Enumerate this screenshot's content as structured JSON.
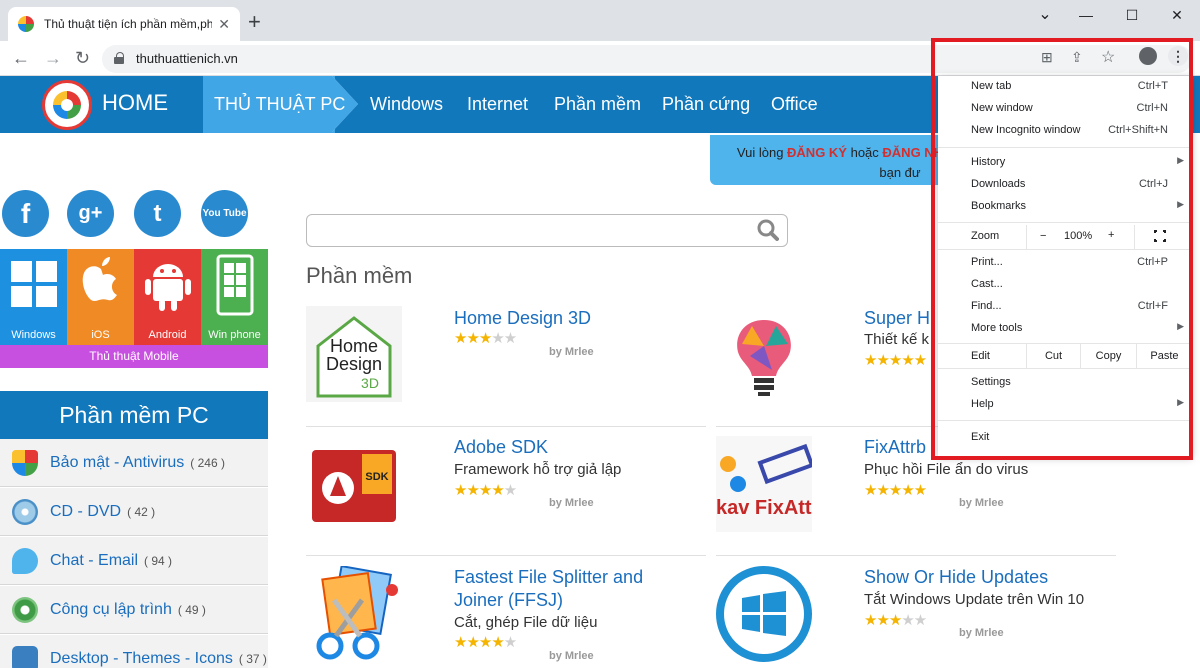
{
  "browser": {
    "tab_title": "Thủ thuật tiện ích phần mềm,phần",
    "tab_close": "✕",
    "new_tab": "+",
    "url": "thuthuattienich.vn",
    "min": "—",
    "max": "☐",
    "close": "✕",
    "chevron": "⌄"
  },
  "nav": {
    "home": "HOME",
    "active": "THỦ THUẬT PC",
    "items": [
      "Windows",
      "Internet",
      "Phần mềm",
      "Phần cứng",
      "Office"
    ]
  },
  "notice": {
    "line1a": "Vui lòng ",
    "line1b": "ĐĂNG KÝ",
    "line1c": " hoặc ",
    "line1d": "ĐĂNG NH",
    "line2": "bạn đư"
  },
  "social": [
    "f",
    "g+",
    "t",
    "You Tube"
  ],
  "mobile": {
    "tiles": [
      "Windows",
      "iOS",
      "Android",
      "Win phone"
    ],
    "bar": "Thủ thuật Mobile"
  },
  "sidebar": {
    "header": "Phần mềm PC",
    "items": [
      {
        "label": "Bảo mật - Antivirus",
        "count": "( 246 )"
      },
      {
        "label": "CD - DVD",
        "count": "( 42 )"
      },
      {
        "label": "Chat - Email",
        "count": "( 94 )"
      },
      {
        "label": "Công cụ lập trình",
        "count": "( 49 )"
      },
      {
        "label": "Desktop - Themes - Icons",
        "count": "( 37 )"
      }
    ]
  },
  "main": {
    "section_title": "Phần mềm",
    "by": "by Mrlee",
    "cards": [
      {
        "title": "Home Design 3D",
        "desc": "",
        "rating": 3
      },
      {
        "title": "Super H",
        "desc": "Thiết kế k",
        "rating": 5
      },
      {
        "title": "Adobe SDK",
        "desc": "Framework hỗ trợ giả lập",
        "rating": 4
      },
      {
        "title": "FixAttrb",
        "desc": "Phục hồi File ẩn do virus",
        "rating": 5
      },
      {
        "title": "Fastest File Splitter and",
        "title2": "Joiner (FFSJ)",
        "desc": "Cắt, ghép File dữ liệu",
        "rating": 4
      },
      {
        "title": "Show Or Hide Updates",
        "desc": "Tắt Windows Update trên Win 10",
        "rating": 3
      }
    ],
    "img_text": {
      "hd1": "Home",
      "hd2": "Design",
      "hd3": "3D",
      "sdk": "SDK",
      "fix": "kav FixAtt"
    }
  },
  "menu": {
    "new_tab": "New tab",
    "new_tab_sc": "Ctrl+T",
    "new_window": "New window",
    "new_window_sc": "Ctrl+N",
    "incognito": "New Incognito window",
    "incognito_sc": "Ctrl+Shift+N",
    "history": "History",
    "downloads": "Downloads",
    "downloads_sc": "Ctrl+J",
    "bookmarks": "Bookmarks",
    "zoom": "Zoom",
    "zoom_minus": "−",
    "zoom_value": "100%",
    "zoom_plus": "+",
    "print": "Print...",
    "print_sc": "Ctrl+P",
    "cast": "Cast...",
    "find": "Find...",
    "find_sc": "Ctrl+F",
    "more_tools": "More tools",
    "edit": "Edit",
    "cut": "Cut",
    "copy": "Copy",
    "paste": "Paste",
    "settings": "Settings",
    "help": "Help",
    "exit": "Exit",
    "arrow": "▶"
  }
}
